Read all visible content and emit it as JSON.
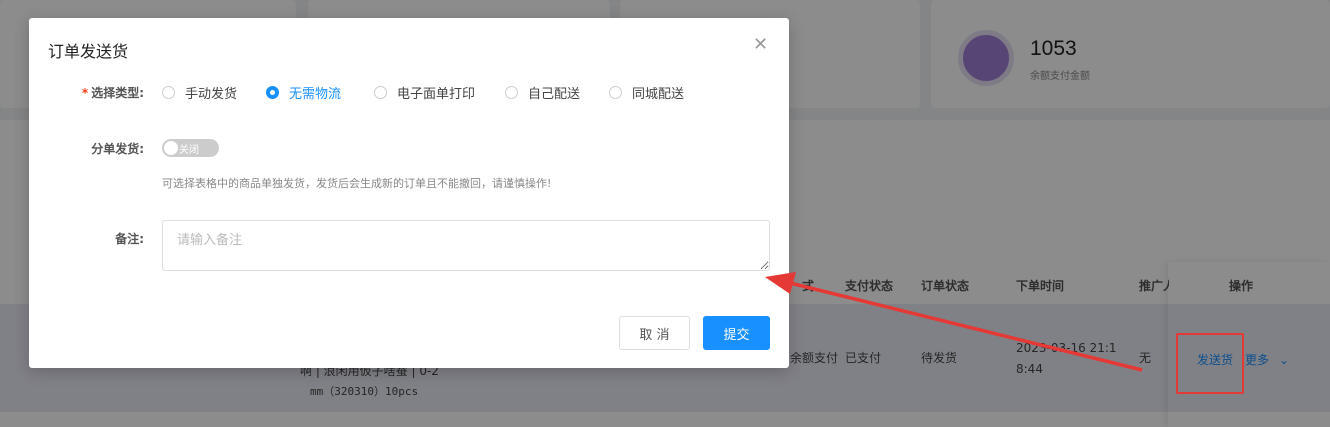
{
  "background": {
    "stat_card": {
      "value": "1053",
      "label": "余额支付金额"
    },
    "table": {
      "headers": {
        "pay_method": "式",
        "pay_status": "支付状态",
        "order_status": "订单状态",
        "order_time": "下单时间",
        "promoter": "推广人",
        "actions": "操作"
      },
      "row": {
        "product_line1": "啊 | 浪闲用仮子啥蚕 | 0-2",
        "product_line2": "mm（320310）10pcs",
        "pay_method": "余额支付",
        "pay_status": "已支付",
        "order_status": "待发货",
        "order_time": "2023-03-16 21:18:44",
        "promoter": "无",
        "ship_link": "发送货",
        "more_link": "更多"
      }
    }
  },
  "modal": {
    "title": "订单发送货",
    "type_label": "选择类型:",
    "type_options": [
      "手动发货",
      "无需物流",
      "电子面单打印",
      "自己配送",
      "同城配送"
    ],
    "type_selected": "无需物流",
    "split_label": "分单发货:",
    "split_switch_text": "关闭",
    "split_hint": "可选择表格中的商品单独发货，发货后会生成新的订单且不能撤回，请谨慎操作!",
    "remark_label": "备注:",
    "remark_placeholder": "请输入备注",
    "cancel_label": "取 消",
    "submit_label": "提交"
  },
  "annotation": {
    "color": "#e53935"
  }
}
